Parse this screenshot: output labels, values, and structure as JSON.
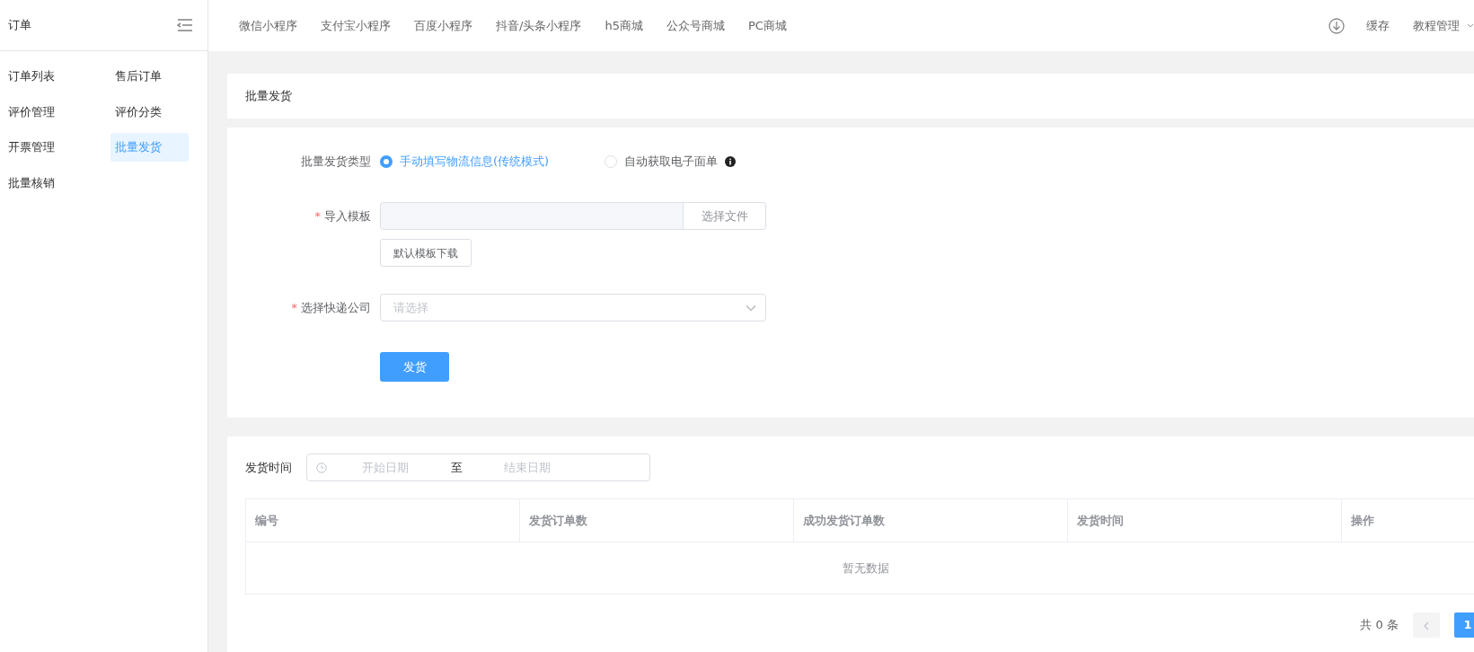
{
  "sidebar": {
    "title": "订单",
    "items": [
      {
        "label": "订单列表",
        "selected": false
      },
      {
        "label": "售后订单",
        "selected": false
      },
      {
        "label": "评价管理",
        "selected": false
      },
      {
        "label": "评价分类",
        "selected": false
      },
      {
        "label": "开票管理",
        "selected": false
      },
      {
        "label": "批量发货",
        "selected": true
      },
      {
        "label": "批量核销",
        "selected": false
      }
    ]
  },
  "top_nav": {
    "links": [
      "微信小程序",
      "支付宝小程序",
      "百度小程序",
      "抖音/头条小程序",
      "h5商城",
      "公众号商城",
      "PC商城"
    ],
    "cache": "缓存",
    "menu": "教程管理"
  },
  "page_title": "批量发货",
  "form": {
    "type_label": "批量发货类型",
    "options": [
      {
        "label": "手动填写物流信息(传统模式)",
        "selected": true
      },
      {
        "label": "自动获取电子面单",
        "selected": false
      }
    ],
    "template_label": "导入模板",
    "template_mark": "*",
    "choose_file": "选择文件",
    "download": "默认模板下载",
    "courier_label": "选择快递公司",
    "courier_mark": "*",
    "courier_placeholder": "请选择",
    "submit": "发货"
  },
  "records": {
    "filter_label": "发货时间",
    "start_placeholder": "开始日期",
    "separator": "至",
    "end_placeholder": "结束日期",
    "columns": [
      "编号",
      "发货订单数",
      "成功发货订单数",
      "发货时间",
      "操作"
    ],
    "empty": "暂无数据",
    "total": "共 0 条",
    "pages": [
      {
        "label": "1",
        "selected": true
      }
    ],
    "prev_disabled": true
  }
}
